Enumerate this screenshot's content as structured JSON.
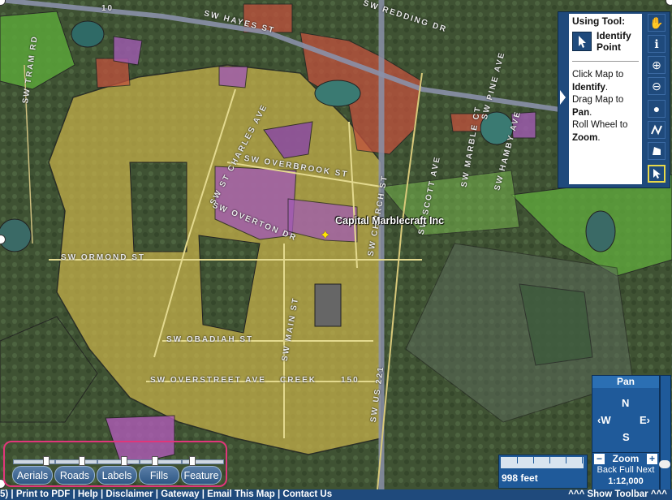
{
  "map": {
    "feature_label": "Capital Marblecraft Inc",
    "street_labels": [
      "SW HAYES ST",
      "SW REDDING DR",
      "SW ST CHARLES AVE",
      "SW OVERBROOK ST",
      "SW OVERTON DR",
      "SW ORMOND ST",
      "SW OBADIAH ST",
      "SW MAIN ST",
      "SW OVERSTREET AVE",
      "CREEK",
      "150",
      "SW US 221",
      "SW CHURCH ST",
      "SW SCOTT AVE",
      "SW TRAM RD",
      "SW MARBLE CT",
      "SW PINE AVE",
      "SW HAMBY AVE"
    ],
    "route_shield": "10"
  },
  "tool_panel": {
    "heading": "Using Tool:",
    "tool_name": "Identify Point",
    "help_lines": [
      {
        "pre": "Click Map to ",
        "bold": "Identify",
        "post": "."
      },
      {
        "pre": "Drag Map to ",
        "bold": "Pan",
        "post": "."
      },
      {
        "pre": "Roll Wheel to ",
        "bold": "Zoom",
        "post": "."
      }
    ],
    "buttons": [
      "pan-hand",
      "info",
      "zoom-in",
      "zoom-out",
      "point-select",
      "line-select",
      "polygon-select",
      "identify-arrow"
    ]
  },
  "pan_control": {
    "title": "Pan",
    "north": "N",
    "south": "S",
    "east": "E",
    "west": "W"
  },
  "zoom_control": {
    "title": "Zoom",
    "minus": "−",
    "plus": "+",
    "links": "Back Full Next",
    "scale": "1:12,000"
  },
  "scale_bar": {
    "label": "998 feet"
  },
  "layers": {
    "buttons": [
      "Aerials",
      "Roads",
      "Labels",
      "Fills",
      "Feature"
    ]
  },
  "bottom_bar": {
    "links_text": "5) | Print to PDF | Help | Disclaimer | Gateway | Email This Map | Contact Us",
    "show_toolbar": "^^^ Show Toolbar ^^^"
  },
  "colors": {
    "panel_blue": "#1f4a7c",
    "highlight_box": "#e0367a",
    "yellow_zone": "#c9b24a",
    "purple_zone": "#a15bb3",
    "red_zone": "#c2513d",
    "green_zone": "#5fa83c"
  }
}
